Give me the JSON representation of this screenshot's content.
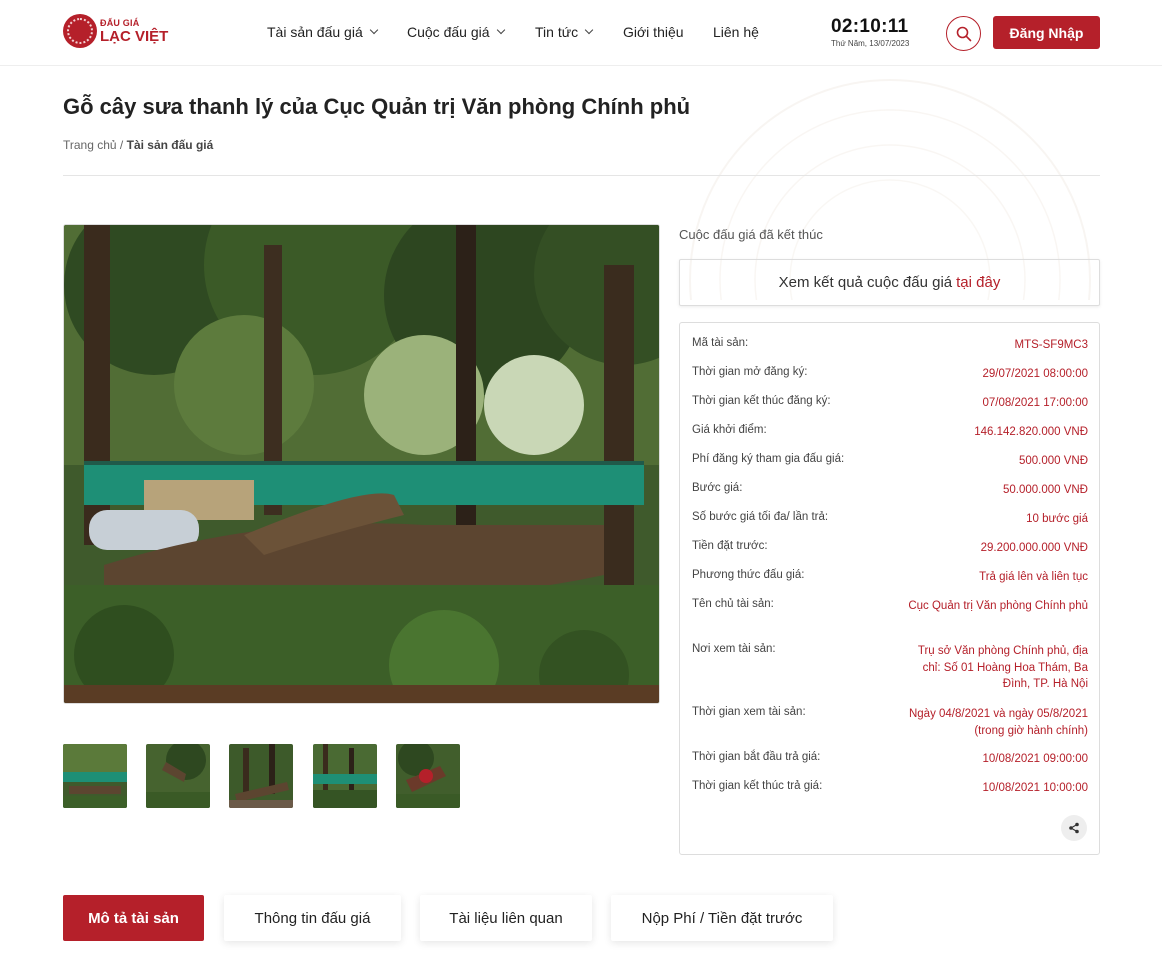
{
  "header": {
    "logo_top": "ĐẤU GIÁ",
    "logo_bottom": "LẠC VIỆT",
    "nav": [
      {
        "label": "Tài sản đấu giá",
        "has_dropdown": true
      },
      {
        "label": "Cuộc đấu giá",
        "has_dropdown": true
      },
      {
        "label": "Tin tức",
        "has_dropdown": true
      },
      {
        "label": "Giới thiệu",
        "has_dropdown": false
      },
      {
        "label": "Liên hệ",
        "has_dropdown": false
      }
    ],
    "clock_time": "02:10:11",
    "clock_date": "Thứ Năm, 13/07/2023",
    "search_icon": "search-icon",
    "login_label": "Đăng Nhập"
  },
  "page": {
    "title": "Gỗ cây sưa thanh lý của Cục Quản trị Văn phòng Chính phủ",
    "breadcrumb_home": "Trang chủ",
    "breadcrumb_sep": " / ",
    "breadcrumb_current": "Tài sản đấu giá"
  },
  "auction": {
    "status": "Cuộc đấu giá đã kết thúc",
    "result_text": "Xem kết quả cuộc đấu giá",
    "result_link": "tại đây",
    "share_icon": "share-icon",
    "info": [
      {
        "label": "Mã tài sản:",
        "value": "MTS-SF9MC3"
      },
      {
        "label": "Thời gian mở đăng ký:",
        "value": "29/07/2021 08:00:00"
      },
      {
        "label": "Thời gian kết thúc đăng ký:",
        "value": "07/08/2021 17:00:00"
      },
      {
        "label": "Giá khởi điểm:",
        "value": "146.142.820.000 VNĐ"
      },
      {
        "label": "Phí đăng ký tham gia đấu giá:",
        "value": "500.000 VNĐ"
      },
      {
        "label": "Bước giá:",
        "value": "50.000.000 VNĐ"
      },
      {
        "label": "Số bước giá tối đa/ lần trả:",
        "value": "10 bước giá"
      },
      {
        "label": "Tiền đặt trước:",
        "value": "29.200.000.000 VNĐ"
      },
      {
        "label": "Phương thức đấu giá:",
        "value": "Trả giá lên và liên tục"
      },
      {
        "label": "Tên chủ tài sản:",
        "value": "Cục Quản trị Văn phòng Chính phủ"
      },
      {
        "label": "Nơi xem tài sản:",
        "value": "Trụ sở Văn phòng Chính phủ, địa chỉ: Số 01 Hoàng Hoa Thám, Ba Đình, TP. Hà Nội"
      },
      {
        "label": "Thời gian xem tài sản:",
        "value": "Ngày 04/8/2021 và ngày 05/8/2021 (trong giờ hành chính)"
      },
      {
        "label": "Thời gian bắt đầu trả giá:",
        "value": "10/08/2021 09:00:00"
      },
      {
        "label": "Thời gian kết thúc trả giá:",
        "value": "10/08/2021 10:00:00"
      }
    ]
  },
  "tabs": [
    {
      "label": "Mô tả tài sản",
      "active": true
    },
    {
      "label": "Thông tin đấu giá",
      "active": false
    },
    {
      "label": "Tài liệu liên quan",
      "active": false
    },
    {
      "label": "Nộp Phí / Tiền đặt trước",
      "active": false
    }
  ],
  "colors": {
    "brand": "#b5202a",
    "text": "#222222",
    "border": "#dddddd"
  }
}
